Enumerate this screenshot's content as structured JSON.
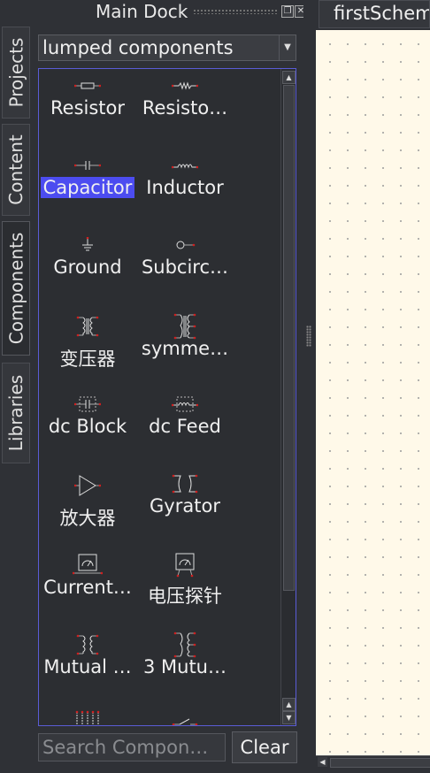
{
  "dock": {
    "title": "Main Dock",
    "float_glyph": "❐",
    "close_glyph": "✕",
    "tabs": [
      "Projects",
      "Content",
      "Components",
      "Libraries"
    ]
  },
  "components": {
    "category": "lumped components",
    "items": [
      {
        "label": "Resistor",
        "icon": "resistor-icon"
      },
      {
        "label": "Resisto…",
        "icon": "resistor-us-icon"
      },
      {
        "label": "Capacitor",
        "icon": "capacitor-icon",
        "selected": true
      },
      {
        "label": "Inductor",
        "icon": "inductor-icon"
      },
      {
        "label": "Ground",
        "icon": "ground-icon"
      },
      {
        "label": "Subcirc…",
        "icon": "subcircuit-port-icon"
      },
      {
        "label": "变压器",
        "icon": "transformer-icon"
      },
      {
        "label": "symme…",
        "icon": "symmetric-transformer-icon"
      },
      {
        "label": "dc Block",
        "icon": "dc-block-icon"
      },
      {
        "label": "dc Feed",
        "icon": "dc-feed-icon"
      },
      {
        "label": "放大器",
        "icon": "amplifier-icon"
      },
      {
        "label": "Gyrator",
        "icon": "gyrator-icon"
      },
      {
        "label": "Current…",
        "icon": "current-probe-icon"
      },
      {
        "label": "电压探针",
        "icon": "voltage-probe-icon"
      },
      {
        "label": "Mutual …",
        "icon": "mutual-inductor-icon"
      },
      {
        "label": "3 Mutu…",
        "icon": "three-mutual-inductors-icon"
      },
      {
        "label": "",
        "icon": "mutual-inductors-multi-icon"
      },
      {
        "label": "",
        "icon": "switch-icon"
      }
    ],
    "search_placeholder": "Search Compon…",
    "clear_label": "Clear"
  },
  "document": {
    "tab_title": "firstSchem"
  },
  "colors": {
    "selection": "#4c4cf0",
    "canvas": "#fff9e9",
    "pin": "#d02020"
  }
}
